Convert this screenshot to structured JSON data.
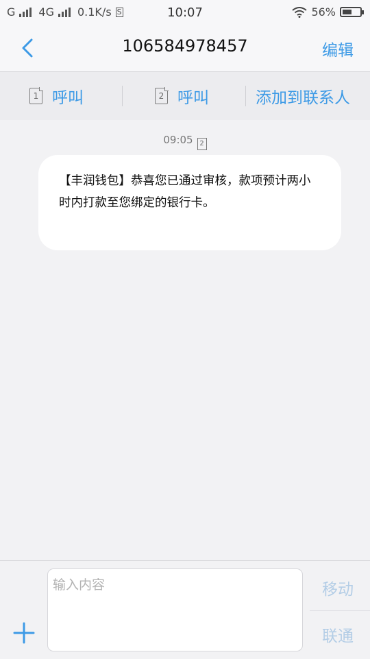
{
  "status_bar": {
    "carrier1": "G",
    "network": "4G",
    "speed": "0.1K/s",
    "s_badge": "S",
    "time": "10:07",
    "battery": "56%",
    "battery_level": 0.56
  },
  "header": {
    "title": "106584978457",
    "edit_label": "编辑"
  },
  "actions": {
    "call_sim1": {
      "sim": "1",
      "label": "呼叫"
    },
    "call_sim2": {
      "sim": "2",
      "label": "呼叫"
    },
    "add_contact": "添加到联系人"
  },
  "messages": [
    {
      "time": "09:05",
      "sim": "2",
      "text": "【丰润钱包】恭喜您已通过审核，款项预计两小时内打款至您绑定的银行卡。"
    }
  ],
  "composer": {
    "placeholder": "输入内容",
    "send_mobile": "移动",
    "send_unicom": "联通"
  },
  "colors": {
    "accent": "#3d9ae6",
    "disabled_accent": "#b3cde6",
    "background": "#f2f2f4"
  }
}
